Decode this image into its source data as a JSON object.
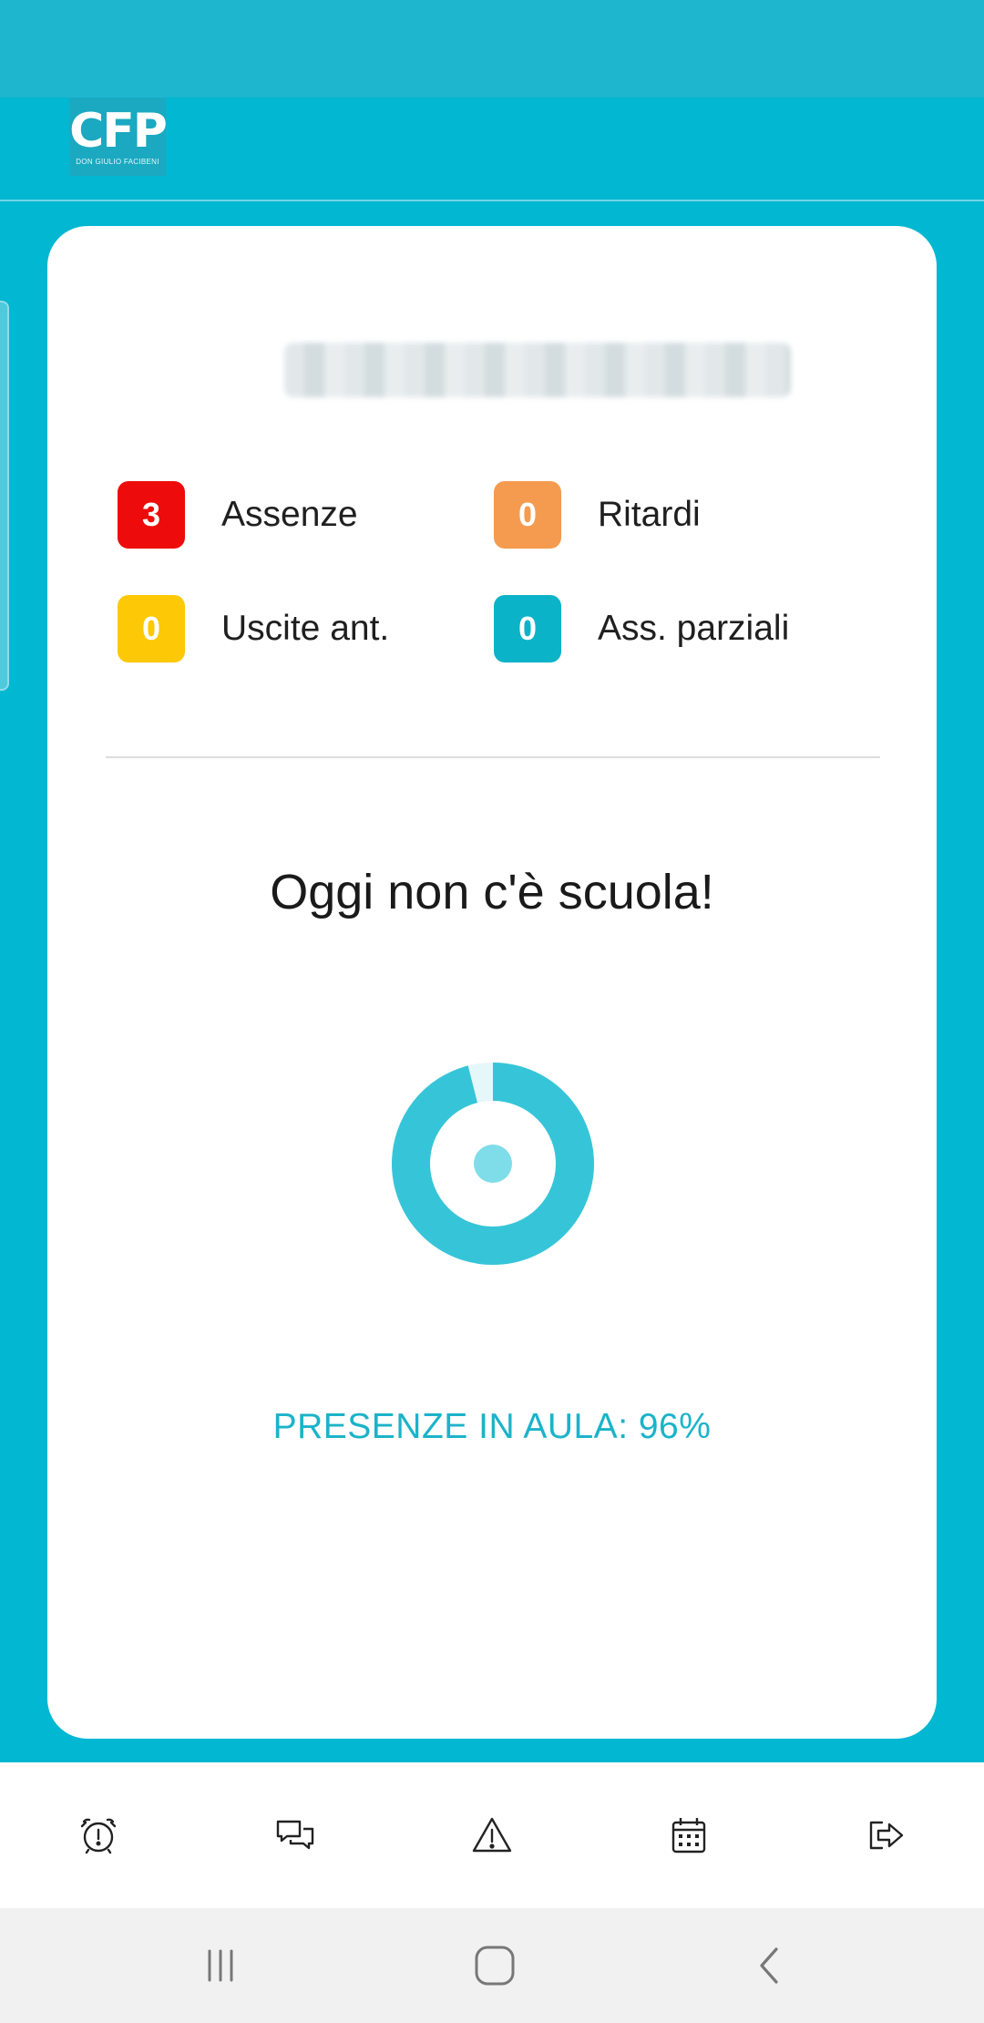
{
  "header": {
    "logo_text": "CFP",
    "logo_subtitle": "DON GIULIO FACIBENI"
  },
  "stats": [
    {
      "value": "3",
      "label": "Assenze",
      "color": "#ee0b0b"
    },
    {
      "value": "0",
      "label": "Ritardi",
      "color": "#f59b4f"
    },
    {
      "value": "0",
      "label": "Uscite ant.",
      "color": "#fdc805"
    },
    {
      "value": "0",
      "label": "Ass. parziali",
      "color": "#0bb3c9"
    }
  ],
  "today": {
    "message": "Oggi non c'è scuola!"
  },
  "attendance": {
    "label": "PRESENZE IN AULA: 96%",
    "percent": 96,
    "ring_color": "#36c5d8",
    "dot_color": "#7fdde9"
  },
  "bottom_nav": [
    {
      "name": "alarm-clock-icon"
    },
    {
      "name": "chat-icon"
    },
    {
      "name": "warning-icon"
    },
    {
      "name": "calendar-icon"
    },
    {
      "name": "logout-icon"
    }
  ],
  "system_nav": [
    "recents-icon",
    "home-icon",
    "back-icon"
  ]
}
